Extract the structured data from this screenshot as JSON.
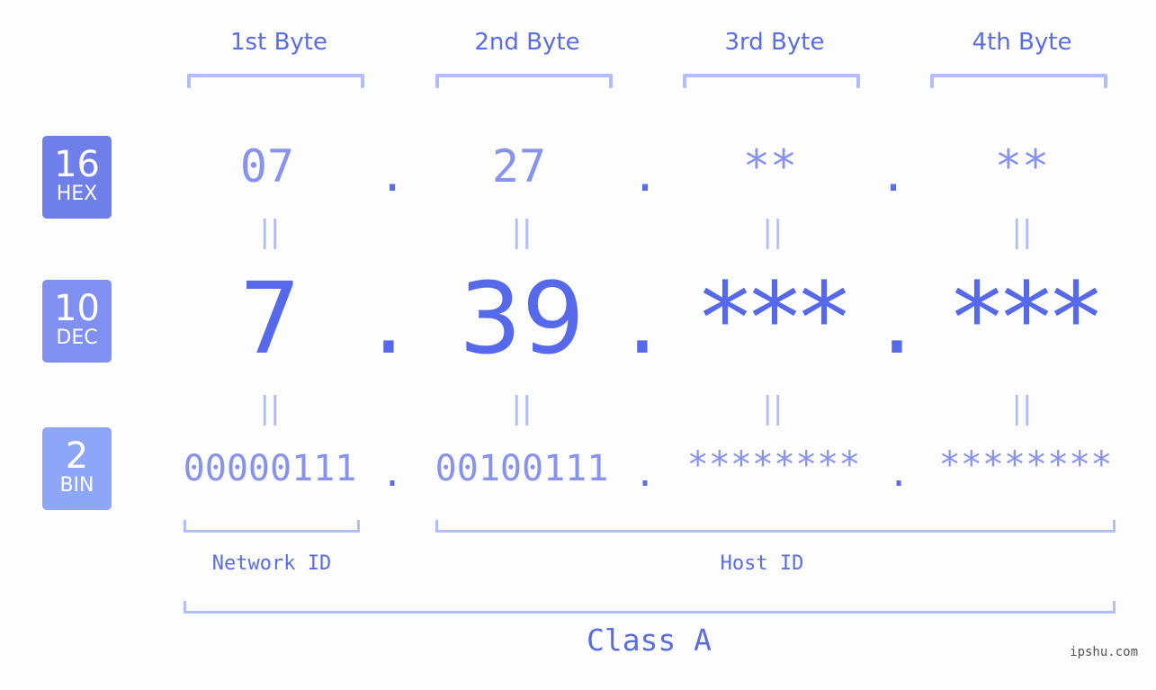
{
  "bytes": {
    "headers": [
      "1st Byte",
      "2nd Byte",
      "3rd Byte",
      "4th Byte"
    ]
  },
  "badges": {
    "hex": {
      "number": "16",
      "label": "HEX",
      "color": "#6f7fe9"
    },
    "dec": {
      "number": "10",
      "label": "DEC",
      "color": "#8090f0"
    },
    "bin": {
      "number": "2",
      "label": "BIN",
      "color": "#8ea6f7"
    }
  },
  "hex": {
    "values": [
      "07",
      "27",
      "**",
      "**"
    ],
    "separator": "."
  },
  "dec": {
    "values": [
      "7",
      "39",
      "***",
      "***"
    ],
    "separator": "."
  },
  "bin": {
    "values": [
      "00000111",
      "00100111",
      "********",
      "********"
    ],
    "separator": "."
  },
  "equals_glyph": "||",
  "ids": {
    "network": "Network ID",
    "host": "Host ID"
  },
  "class_label": "Class A",
  "watermark": "ipshu.com",
  "colors": {
    "accent": "#5569ea",
    "light": "#8893ef",
    "bracket": "#b3bdf7"
  }
}
